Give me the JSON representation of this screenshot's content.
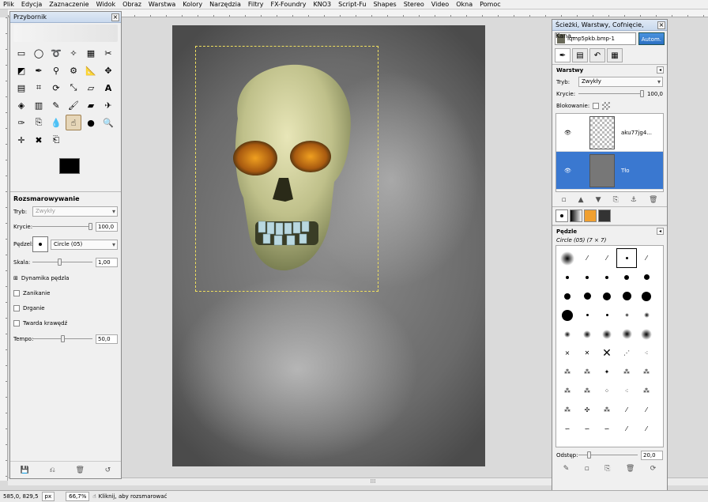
{
  "menubar": {
    "items": [
      "Plik",
      "Edycja",
      "Zaznaczenie",
      "Widok",
      "Obraz",
      "Warstwa",
      "Kolory",
      "Narzędzia",
      "Filtry",
      "FX-Foundry",
      "KNO3",
      "Script-Fu",
      "Shapes",
      "Stereo",
      "Video",
      "Okna",
      "Pomoc"
    ]
  },
  "toolbox": {
    "title": "Przybornik",
    "close": "×",
    "tool_options": {
      "title": "Rozsmarowywanie",
      "mode_label": "Tryb:",
      "mode_value": "Zwykły",
      "opacity_label": "Krycie:",
      "opacity_value": "100,0",
      "opacity_fraction": 1.0,
      "brush_label": "Pędzel:",
      "brush_value": "Circle (05)",
      "scale_label": "Skala:",
      "scale_value": "1,00",
      "scale_fraction": 0.45,
      "dynamics_label": "Dynamika pędzla",
      "fade_label": "Zanikanie",
      "jitter_label": "Drganie",
      "hard_edge_label": "Twarda krawędź",
      "rate_label": "Tempo:",
      "rate_value": "50,0",
      "rate_fraction": 0.5
    }
  },
  "dock": {
    "title": "Ścieżki, Warstwy, Cofnięcie, Kana...",
    "close": "×",
    "image_select": "lqmp5pkb.bmp-1",
    "auto_button": "Autom.",
    "layers_panel": {
      "title": "Warstwy",
      "mode_label": "Tryb:",
      "mode_value": "Zwykły",
      "opacity_label": "Krycie:",
      "opacity_value": "100,0",
      "lock_label": "Blokowanie:",
      "layers": [
        {
          "name": "aku77jg4..."
        },
        {
          "name": "Tło"
        }
      ]
    },
    "brushes_panel": {
      "title": "Pędzle",
      "selected_brush": "Circle (05) (7 × 7)",
      "spacing_label": "Odstęp:",
      "spacing_value": "20,0"
    }
  },
  "statusbar": {
    "coords": "585,0, 829,5",
    "unit": "px",
    "zoom": "66,7%",
    "message": "Kliknij, aby rozsmarować"
  },
  "colors": {
    "accent": "#3a78d0",
    "canvas_bg": "#dadada",
    "fg_color": "#000000",
    "bg_color": "#ffffff"
  }
}
